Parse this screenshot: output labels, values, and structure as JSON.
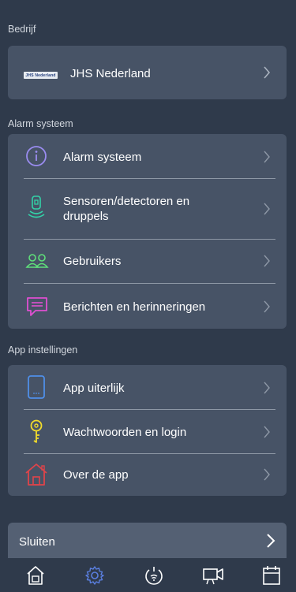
{
  "sections": {
    "company": {
      "title": "Bedrijf"
    },
    "alarm": {
      "title": "Alarm systeem"
    },
    "app": {
      "title": "App instellingen"
    }
  },
  "company_card": {
    "logo_text": "JHS Nederland",
    "name": "JHS Nederland"
  },
  "alarm_items": [
    {
      "label": "Alarm systeem",
      "icon": "info-icon",
      "color": "#9a8cf0"
    },
    {
      "label": "Sensoren/detectoren en",
      "label2": "druppels",
      "icon": "sensor-icon",
      "color": "#33d3a8"
    },
    {
      "label": "Gebruikers",
      "icon": "users-icon",
      "color": "#5fe07a"
    },
    {
      "label": "Berichten en herinneringen",
      "icon": "message-icon",
      "color": "#e04fd2"
    }
  ],
  "app_items": [
    {
      "label": "App uiterlijk",
      "icon": "tablet-icon",
      "color": "#4f8fe8"
    },
    {
      "label": "Wachtwoorden en login",
      "icon": "key-icon",
      "color": "#f2dc2b"
    },
    {
      "label": "Over de app",
      "icon": "house-icon",
      "color": "#e0444a"
    }
  ],
  "close": {
    "label": "Sluiten"
  },
  "tabbar": {
    "tabs": [
      {
        "name": "home-tab",
        "icon": "home-icon"
      },
      {
        "name": "settings-tab",
        "icon": "gear-icon",
        "active": true
      },
      {
        "name": "alarm-tab",
        "icon": "power-wifi-icon"
      },
      {
        "name": "camera-tab",
        "icon": "camera-icon"
      },
      {
        "name": "calendar-tab",
        "icon": "calendar-icon"
      }
    ],
    "active_color": "#5a7fe0",
    "inactive_color": "#ffffff"
  }
}
